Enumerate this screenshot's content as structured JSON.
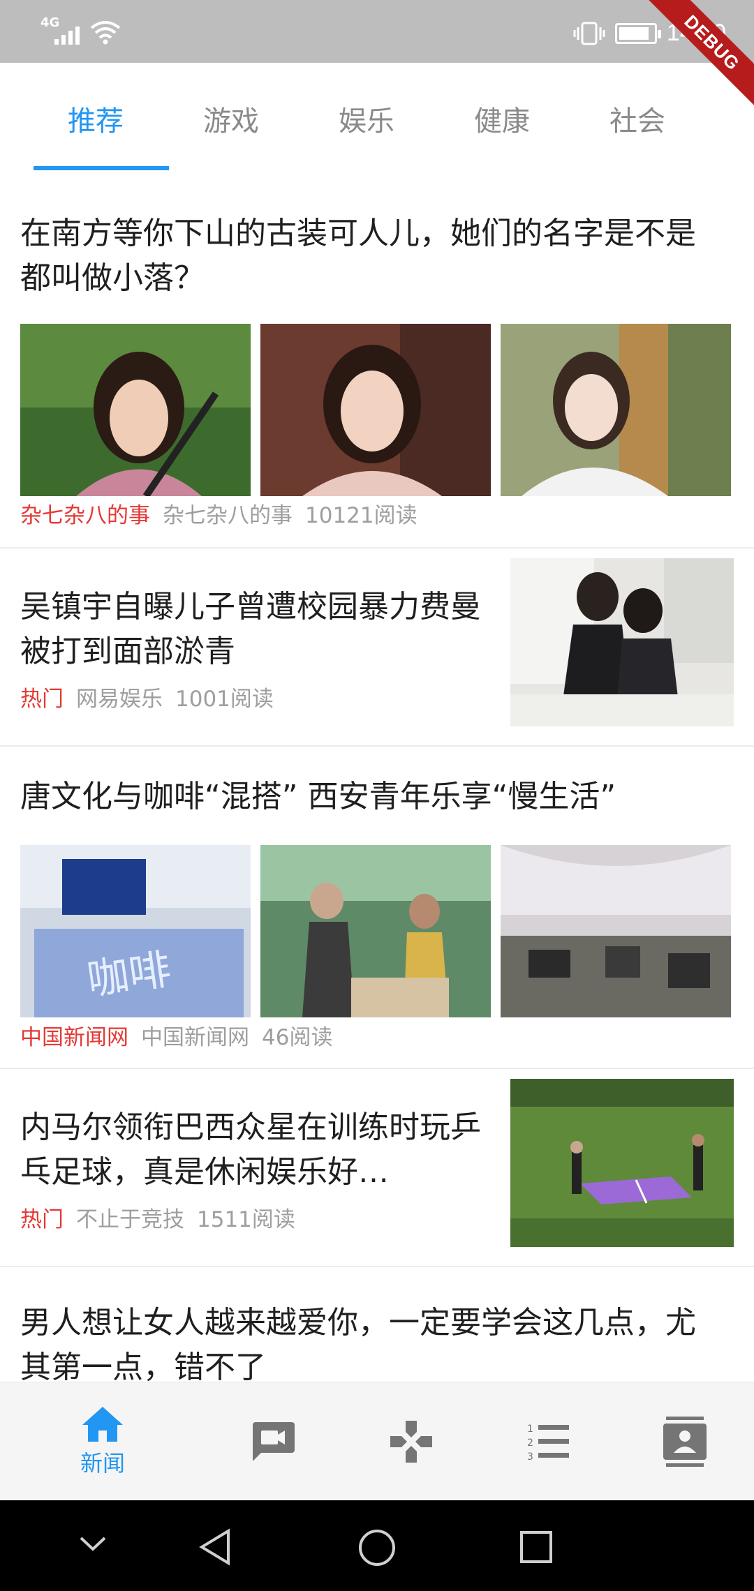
{
  "status_bar": {
    "network_type": "4G",
    "time": "14:00",
    "debug_label": "DEBUG"
  },
  "tabs": [
    {
      "label": "推荐",
      "active": true
    },
    {
      "label": "游戏",
      "active": false
    },
    {
      "label": "娱乐",
      "active": false
    },
    {
      "label": "健康",
      "active": false
    },
    {
      "label": "社会",
      "active": false
    }
  ],
  "feed": [
    {
      "layout": "three-images",
      "title": "在南方等你下山的古装可人儿，她们的名字是不是都叫做小落？",
      "tag": "杂七杂八的事",
      "source": "杂七杂八的事",
      "reads": "10121阅读"
    },
    {
      "layout": "right-image",
      "title": "吴镇宇自曝儿子曾遭校园暴力费曼被打到面部淤青",
      "tag": "热门",
      "source": "网易娱乐",
      "reads": "1001阅读"
    },
    {
      "layout": "three-images",
      "title": "唐文化与咖啡“混搭” 西安青年乐享“慢生活”",
      "tag": "中国新闻网",
      "source": "中国新闻网",
      "reads": "46阅读"
    },
    {
      "layout": "right-image",
      "title": "内马尔领衔巴西众星在训练时玩乒乓足球，真是休闲娱乐好…",
      "tag": "热门",
      "source": "不止于竞技",
      "reads": "1511阅读"
    },
    {
      "layout": "partial",
      "title": "男人想让女人越来越爱你，一定要学会这几点，尤其第一点，错不了"
    }
  ],
  "bottom_nav": {
    "items": [
      {
        "icon": "home-icon",
        "label": "新闻",
        "active": true
      },
      {
        "icon": "chat-video-icon",
        "label": "",
        "active": false
      },
      {
        "icon": "gamepad-icon",
        "label": "",
        "active": false
      },
      {
        "icon": "numbered-list-icon",
        "label": "",
        "active": false
      },
      {
        "icon": "contact-card-icon",
        "label": "",
        "active": false
      }
    ],
    "active_color": "#2196f3",
    "inactive_color": "#757575"
  },
  "colors": {
    "accent": "#2196f3",
    "tag_red": "#e53935",
    "status_bar": "#bdbdbd"
  }
}
